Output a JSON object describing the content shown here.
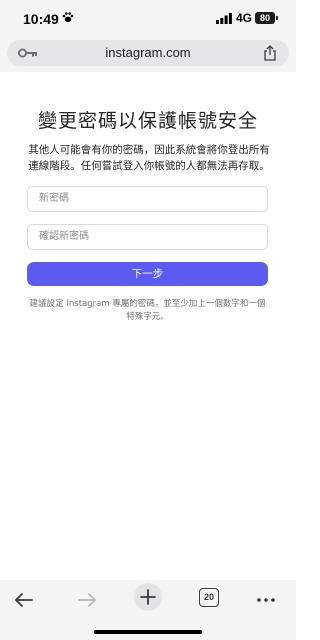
{
  "status_bar": {
    "time": "10:49",
    "network": "4G",
    "battery": "80"
  },
  "browser": {
    "url": "instagram.com",
    "open_tabs": "20"
  },
  "page": {
    "title": "變更密碼以保護帳號安全",
    "subtitle": "其他人可能會有你的密碼，因此系統會將你登出所有連線階段。任何嘗試登入你帳號的人都無法再存取。",
    "new_password_placeholder": "新密碼",
    "confirm_password_placeholder": "確認新密碼",
    "next_label": "下一步",
    "hint": "建議設定 Instagram 專屬的密碼，並至少加上一個數字和一個特殊字元。"
  },
  "colors": {
    "primary_button": "#5b5bf2",
    "field_border": "#dbdbdb"
  },
  "icons": [
    "paw-icon",
    "signal-icon",
    "battery-icon",
    "key-icon",
    "share-icon",
    "back-arrow-icon",
    "forward-arrow-icon",
    "plus-icon",
    "tabs-icon",
    "more-icon"
  ]
}
